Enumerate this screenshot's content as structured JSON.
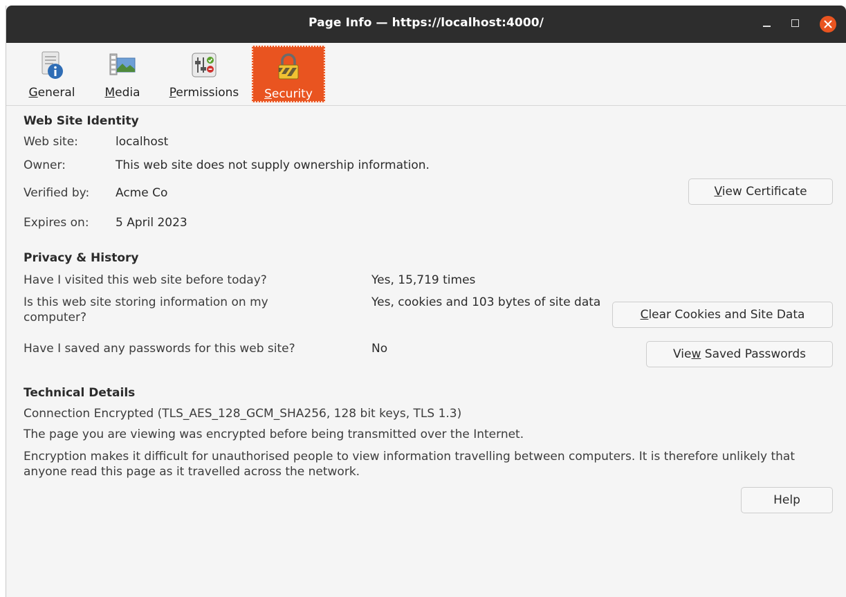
{
  "window": {
    "title": "Page Info — https://localhost:4000/"
  },
  "tabs": [
    {
      "label_pre": "",
      "label_ul": "G",
      "label_post": "eneral",
      "icon": "document-info-icon"
    },
    {
      "label_pre": "",
      "label_ul": "M",
      "label_post": "edia",
      "icon": "media-film-icon"
    },
    {
      "label_pre": "",
      "label_ul": "P",
      "label_post": "ermissions",
      "icon": "permissions-icon"
    },
    {
      "label_pre": "",
      "label_ul": "S",
      "label_post": "ecurity",
      "icon": "padlock-icon",
      "active": true
    }
  ],
  "identity": {
    "heading": "Web Site Identity",
    "website_label": "Web site:",
    "website_value": "localhost",
    "owner_label": "Owner:",
    "owner_value": "This web site does not supply ownership information.",
    "verified_label": "Verified by:",
    "verified_value": "Acme Co",
    "expires_label": "Expires on:",
    "expires_value": "5 April 2023",
    "view_cert_ul": "V",
    "view_cert_post": "iew Certificate"
  },
  "privacy": {
    "heading": "Privacy & History",
    "visited_q": "Have I visited this web site before today?",
    "visited_a": "Yes, 15,719 times",
    "storing_q": "Is this web site storing information on my computer?",
    "storing_a": "Yes, cookies and 103 bytes of site data",
    "clear_ul": "C",
    "clear_post": "lear Cookies and Site Data",
    "passwords_q": "Have I saved any passwords for this web site?",
    "passwords_a": "No",
    "view_pw_pre": "Vie",
    "view_pw_ul": "w",
    "view_pw_post": " Saved Passwords"
  },
  "technical": {
    "heading": "Technical Details",
    "line1": "Connection Encrypted (TLS_AES_128_GCM_SHA256, 128 bit keys, TLS 1.3)",
    "line2": "The page you are viewing was encrypted before being transmitted over the Internet.",
    "line3": "Encryption makes it difficult for unauthorised people to view information travelling between computers. It is therefore unlikely that anyone read this page as it travelled across the network."
  },
  "help_button": "Help",
  "colors": {
    "accent": "#e95420",
    "titlebar": "#2d2d2d",
    "background": "#f5f5f5"
  }
}
